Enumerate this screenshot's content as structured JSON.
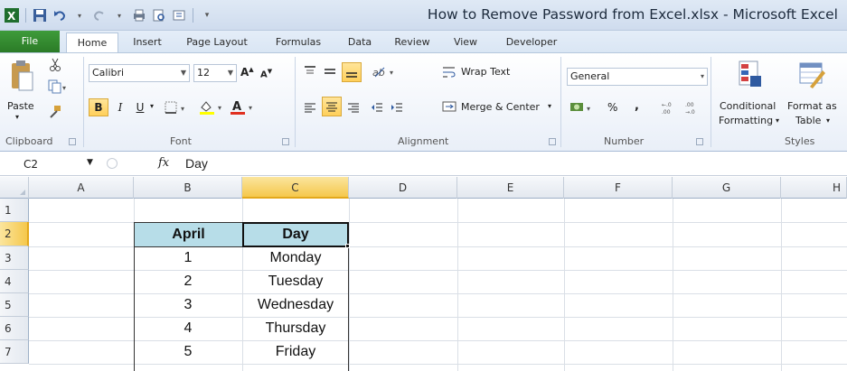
{
  "app": {
    "title": "How to Remove Password from Excel.xlsx  -  Microsoft Excel"
  },
  "ribbon_tabs": [
    "File",
    "Home",
    "Insert",
    "Page Layout",
    "Formulas",
    "Data",
    "Review",
    "View",
    "Developer"
  ],
  "ribbon": {
    "clipboard": {
      "paste": "Paste",
      "label": "Clipboard"
    },
    "font": {
      "name": "Calibri",
      "size": "12",
      "bold": "B",
      "italic": "I",
      "underline": "U",
      "label": "Font"
    },
    "alignment": {
      "wrap": "Wrap Text",
      "merge": "Merge & Center",
      "label": "Alignment"
    },
    "number": {
      "format": "General",
      "percent": "%",
      "comma": ",",
      "label": "Number"
    },
    "styles": {
      "conditional_1": "Conditional",
      "conditional_2": "Formatting",
      "format_as_1": "Format as",
      "format_as_2": "Table",
      "label": "Styles"
    }
  },
  "formula_bar": {
    "name_box": "C2",
    "fx": "fx",
    "content": "Day"
  },
  "columns": [
    "A",
    "B",
    "C",
    "D",
    "E",
    "F",
    "G",
    "H"
  ],
  "rows": [
    "1",
    "2",
    "3",
    "4",
    "5",
    "6",
    "7"
  ],
  "sheet": {
    "headers": [
      "April",
      "Day"
    ],
    "data": [
      [
        "1",
        "Monday"
      ],
      [
        "2",
        "Tuesday"
      ],
      [
        "3",
        "Wednesday"
      ],
      [
        "4",
        "Thursday"
      ],
      [
        "5",
        "Friday"
      ]
    ]
  },
  "colors": {
    "file_tab": "#2b7b27",
    "header_fill": "#b7dde8",
    "selection": "#f5c84c"
  }
}
